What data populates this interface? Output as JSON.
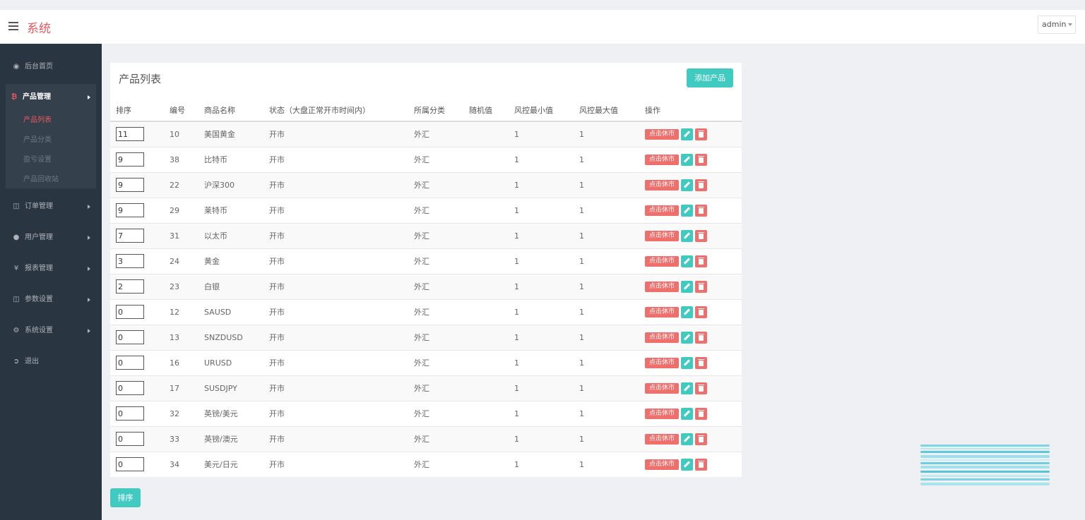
{
  "header": {
    "brand": "系统",
    "user": "admin"
  },
  "sidebar": {
    "home": "后台首页",
    "product_group": {
      "label": "产品管理",
      "items": [
        "产品列表",
        "产品分类",
        "盈亏设置",
        "产品回收站"
      ]
    },
    "orders": "订单管理",
    "users": "用户管理",
    "reports": "报表管理",
    "params": "参数设置",
    "system": "系统设置",
    "logout": "退出"
  },
  "panel": {
    "title": "产品列表",
    "add_button": "添加产品",
    "columns": [
      "排序",
      "编号",
      "商品名称",
      "状态（大盘正常开市时间内）",
      "所属分类",
      "随机值",
      "风控最小值",
      "风控最大值",
      "操作"
    ],
    "rows": [
      {
        "sort": "11",
        "id": "10",
        "name": "美国黄金",
        "status": "开市",
        "category": "外汇",
        "random": "",
        "min": "1",
        "max": "1"
      },
      {
        "sort": "9",
        "id": "38",
        "name": "比特币",
        "status": "开市",
        "category": "外汇",
        "random": "",
        "min": "1",
        "max": "1"
      },
      {
        "sort": "9",
        "id": "22",
        "name": "沪深300",
        "status": "开市",
        "category": "外汇",
        "random": "",
        "min": "1",
        "max": "1"
      },
      {
        "sort": "9",
        "id": "29",
        "name": "莱特币",
        "status": "开市",
        "category": "外汇",
        "random": "",
        "min": "1",
        "max": "1"
      },
      {
        "sort": "7",
        "id": "31",
        "name": "以太币",
        "status": "开市",
        "category": "外汇",
        "random": "",
        "min": "1",
        "max": "1"
      },
      {
        "sort": "3",
        "id": "24",
        "name": "黄金",
        "status": "开市",
        "category": "外汇",
        "random": "",
        "min": "1",
        "max": "1"
      },
      {
        "sort": "2",
        "id": "23",
        "name": "白银",
        "status": "开市",
        "category": "外汇",
        "random": "",
        "min": "1",
        "max": "1"
      },
      {
        "sort": "0",
        "id": "12",
        "name": "SAUSD",
        "status": "开市",
        "category": "外汇",
        "random": "",
        "min": "1",
        "max": "1"
      },
      {
        "sort": "0",
        "id": "13",
        "name": "SNZDUSD",
        "status": "开市",
        "category": "外汇",
        "random": "",
        "min": "1",
        "max": "1"
      },
      {
        "sort": "0",
        "id": "16",
        "name": "URUSD",
        "status": "开市",
        "category": "外汇",
        "random": "",
        "min": "1",
        "max": "1"
      },
      {
        "sort": "0",
        "id": "17",
        "name": "SUSDJPY",
        "status": "开市",
        "category": "外汇",
        "random": "",
        "min": "1",
        "max": "1"
      },
      {
        "sort": "0",
        "id": "32",
        "name": "英镑/美元",
        "status": "开市",
        "category": "外汇",
        "random": "",
        "min": "1",
        "max": "1"
      },
      {
        "sort": "0",
        "id": "33",
        "name": "英镑/澳元",
        "status": "开市",
        "category": "外汇",
        "random": "",
        "min": "1",
        "max": "1"
      },
      {
        "sort": "0",
        "id": "34",
        "name": "美元/日元",
        "status": "开市",
        "category": "外汇",
        "random": "",
        "min": "1",
        "max": "1"
      }
    ],
    "close_market_label": "点击休市"
  },
  "sort_button": "排序",
  "colors": {
    "accent": "#41cac0",
    "danger": "#ef6f6c",
    "brand": "#e9585f",
    "sidebar": "#2a3542"
  }
}
